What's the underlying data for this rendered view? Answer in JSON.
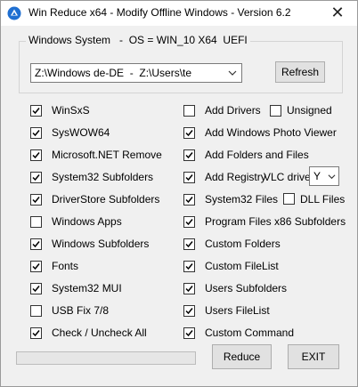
{
  "window": {
    "title": "Win Reduce x64 - Modify Offline Windows - Version 6.2",
    "close_glyph": "✕"
  },
  "group": {
    "legend": "Windows System   -  OS = WIN_10 X64  UEFI"
  },
  "path_select": {
    "value": "Z:\\Windows de-DE  -  Z:\\Users\\te"
  },
  "buttons": {
    "refresh": "Refresh",
    "reduce": "Reduce",
    "exit": "EXIT"
  },
  "left_options": [
    {
      "label": "WinSxS",
      "checked": true
    },
    {
      "label": "SysWOW64",
      "checked": true
    },
    {
      "label": "Microsoft.NET Remove",
      "checked": true
    },
    {
      "label": "System32 Subfolders",
      "checked": true
    },
    {
      "label": "DriverStore Subfolders",
      "checked": true
    },
    {
      "label": "Windows Apps",
      "checked": false
    },
    {
      "label": "Windows Subfolders",
      "checked": true
    },
    {
      "label": "Fonts",
      "checked": true
    },
    {
      "label": "System32 MUI",
      "checked": true
    },
    {
      "label": "USB Fix 7/8",
      "checked": false
    },
    {
      "label": "Check / Uncheck All",
      "checked": true
    }
  ],
  "right_options": [
    {
      "label": "Add Drivers",
      "checked": false
    },
    {
      "label": "Add Windows Photo Viewer",
      "checked": true
    },
    {
      "label": "Add Folders and Files",
      "checked": true
    },
    {
      "label": "Add Registry",
      "checked": true
    },
    {
      "label": "System32 Files",
      "checked": true
    },
    {
      "label": "Program Files x86 Subfolders",
      "checked": true
    },
    {
      "label": "Custom Folders",
      "checked": true
    },
    {
      "label": "Custom FileList",
      "checked": true
    },
    {
      "label": "Users Subfolders",
      "checked": true
    },
    {
      "label": "Users FileList",
      "checked": true
    },
    {
      "label": "Custom Command",
      "checked": true
    }
  ],
  "extra_options": {
    "unsigned": {
      "label": "Unsigned",
      "checked": false
    },
    "dll_files": {
      "label": "DLL Files",
      "checked": false
    }
  },
  "vlc": {
    "label": "VLC drive",
    "value": "Y"
  },
  "progress": {
    "fraction": 0
  },
  "colors": {
    "accent": "#0078d7",
    "progress_fill": "#06b025"
  }
}
